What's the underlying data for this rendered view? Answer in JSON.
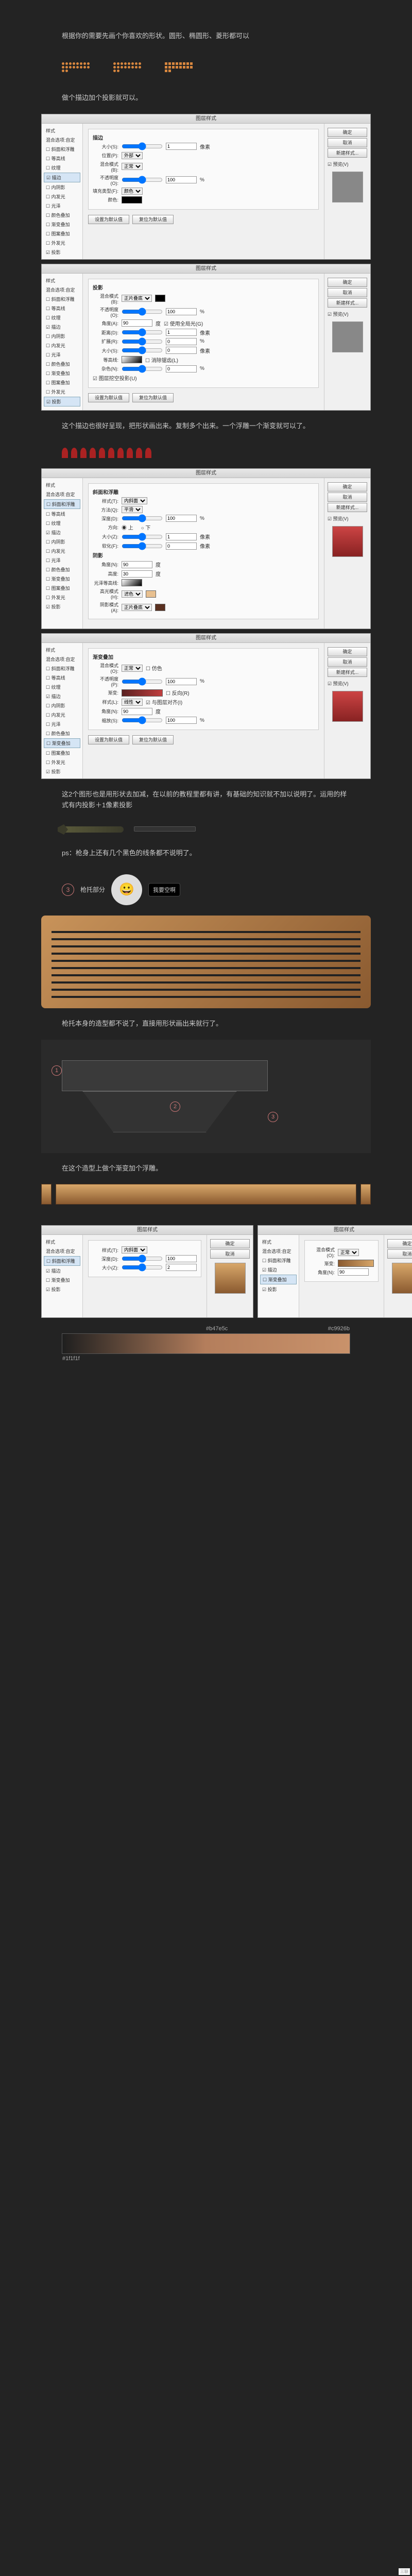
{
  "texts": {
    "t1": "根据你的需要先画个你喜欢的形状。圆形、椭圆形、菱形都可以",
    "t2": "做个描边加个投影就可以。",
    "t3": "这个描边也很好呈现，把形状画出来。复制多个出来。一个浮雕一个渐变就可以了。",
    "t4": "这2个图形也是用形状去加减，在以前的教程里都有讲，有基础的知识就不加以说明了。运用的样式有内投影＋1像素投影",
    "t5": "ps：枪身上还有几个黑色的线条都不说明了。",
    "t6": "枪托本身的造型都不说了，直接用形状画出来就行了。",
    "t7": "在这个造型上做个渐变加个浮雕。",
    "section3": "枪托部分",
    "speech": "我要空啊"
  },
  "panel": {
    "title": "图层样式",
    "ok": "确定",
    "cancel": "取消",
    "newstyle": "新建样式...",
    "preview": "☑ 预览(V)",
    "side": [
      "样式",
      "混合选项:自定",
      "☐ 斜面和浮雕",
      "☐ 等高线",
      "☐ 纹理",
      "☑ 描边",
      "☐ 内阴影",
      "☐ 内发光",
      "☐ 光泽",
      "☐ 颜色叠加",
      "☐ 渐变叠加",
      "☐ 图案叠加",
      "☐ 外发光",
      "☑ 投影"
    ],
    "stroke": {
      "label": "描边",
      "size": "大小(S):",
      "pos": "位置(P):",
      "posv": "外部",
      "blend": "混合模式(B):",
      "blendv": "正常",
      "opacity": "不透明度(O):",
      "fill": "填充类型(F):",
      "fillv": "颜色",
      "color": "颜色:"
    },
    "shadow": {
      "label": "投影",
      "blend": "混合模式(B):",
      "blendv": "正片叠底",
      "opacity": "不透明度(O):",
      "angle": "角度(A):",
      "global": "☑ 使用全局光(G)",
      "dist": "距离(D):",
      "spread": "扩展(R):",
      "size": "大小(S):",
      "contour": "等高线:",
      "anti": "☐ 消除锯齿(L)",
      "noise": "杂色(N):",
      "knockout": "☑ 图层挖空投影(U)"
    },
    "bevel": {
      "label": "斜面和浮雕",
      "style": "样式(T):",
      "stylev": "内斜面",
      "tech": "方法(Q):",
      "techv": "平滑",
      "depth": "深度(D):",
      "dir": "方向:",
      "up": "◉ 上",
      "down": "○ 下",
      "size": "大小(Z):",
      "soften": "软化(F):",
      "shade": "阴影",
      "angle": "角度(N):",
      "alt": "高度:",
      "gloss": "光泽等高线:",
      "hl": "高光模式(H):",
      "hlv": "滤色",
      "sm": "阴影模式(A):",
      "smv": "正片叠底"
    },
    "grad": {
      "label": "渐变叠加",
      "blend": "混合模式(O):",
      "blendv": "正常",
      "dither": "☐ 仿色",
      "opacity": "不透明度(P):",
      "grad": "渐变:",
      "rev": "☐ 反向(R)",
      "style": "样式(L):",
      "stylev": "线性",
      "align": "☑ 与图层对齐(I)",
      "angle": "角度(N):",
      "scale": "缩放(S):"
    },
    "defaults": "设置为默认值",
    "reset": "复位为默认值"
  },
  "colors": {
    "c1": "#b47e5c",
    "c2": "#c9926b",
    "c3": "#1f1f1f"
  },
  "watermark": "三联"
}
